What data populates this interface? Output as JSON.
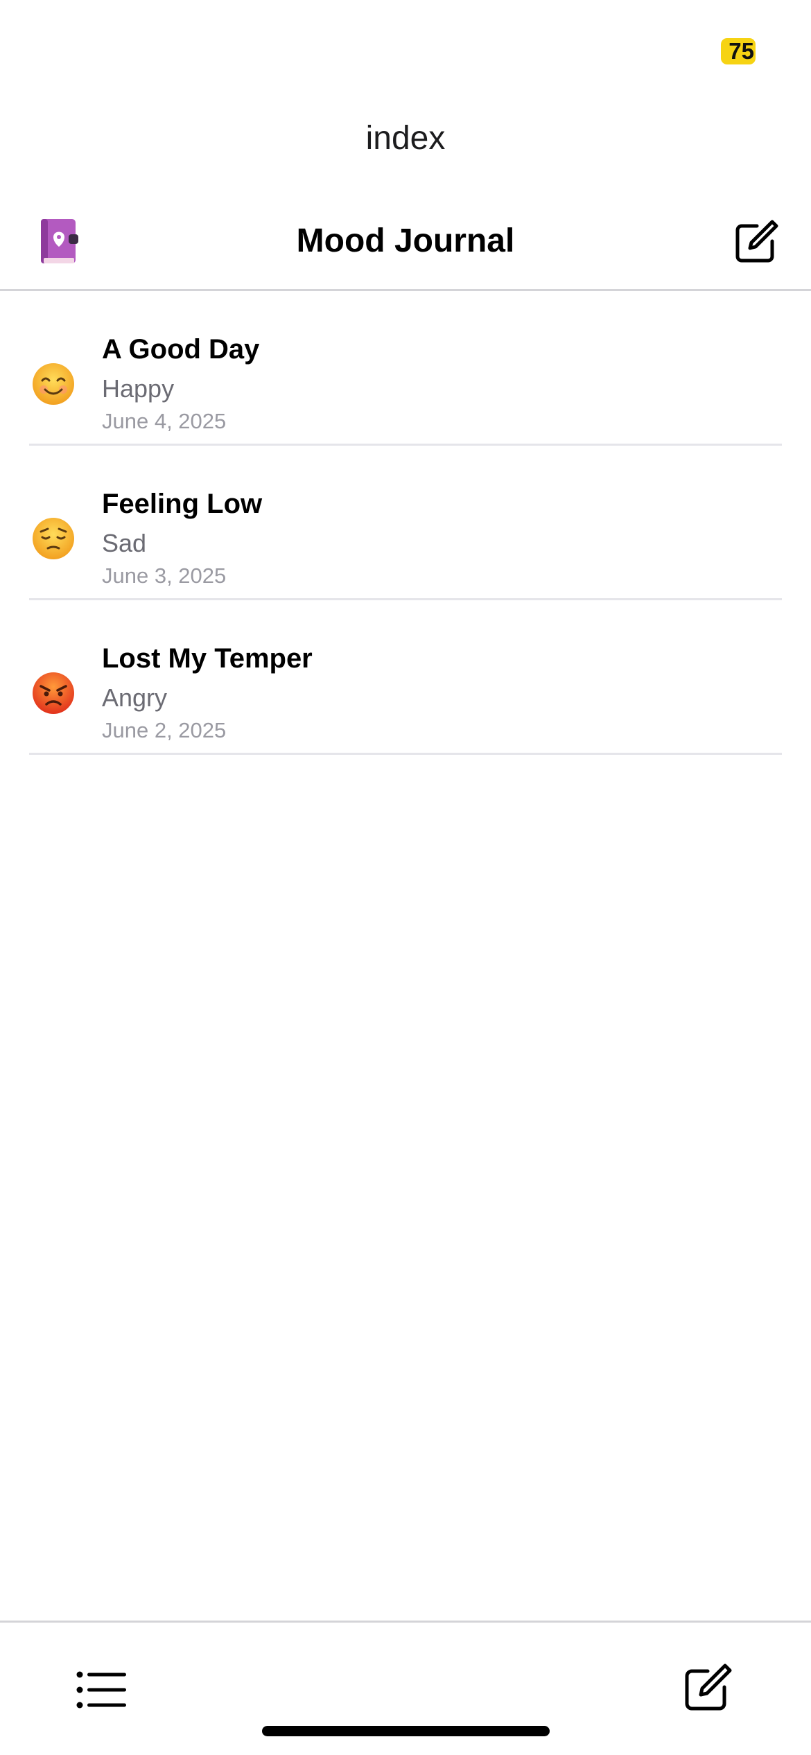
{
  "status_bar": {
    "battery": "75",
    "battery_color": "#f6d313"
  },
  "route": {
    "title": "index"
  },
  "header": {
    "title": "Mood Journal",
    "left_icon": "journal-book-icon",
    "right_icon": "compose-icon"
  },
  "entries": [
    {
      "title": "A Good Day",
      "mood": "Happy",
      "date": "June 4, 2025",
      "emoji_icon": "smiling-face-icon"
    },
    {
      "title": "Feeling Low",
      "mood": "Sad",
      "date": "June 3, 2025",
      "emoji_icon": "pensive-face-icon"
    },
    {
      "title": "Lost My Temper",
      "mood": "Angry",
      "date": "June 2, 2025",
      "emoji_icon": "angry-face-icon"
    }
  ],
  "tab_bar": {
    "left_icon": "list-icon",
    "right_icon": "compose-icon"
  }
}
